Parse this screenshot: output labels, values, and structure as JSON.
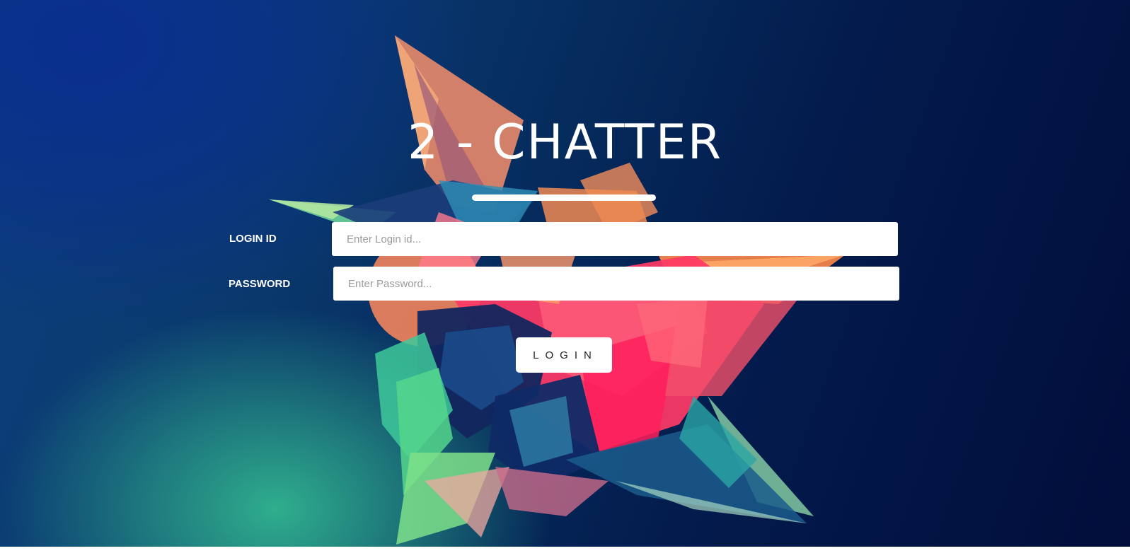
{
  "app": {
    "title": "2 - CHATTER"
  },
  "form": {
    "login_id_label": "LOGIN ID",
    "login_id_placeholder": "Enter Login id...",
    "login_id_value": "",
    "password_label": "PASSWORD",
    "password_placeholder": "Enter Password...",
    "password_value": "",
    "submit_label": "LOGIN"
  },
  "theme": {
    "background_top_left": "#0a2f8f",
    "background_right": "#020d3b",
    "background_bottom_left": "#2fae8d",
    "accent_pink": "#ff2d6b",
    "accent_orange": "#ff8a4c",
    "accent_green": "#4de08a",
    "text_color": "#ffffff"
  }
}
